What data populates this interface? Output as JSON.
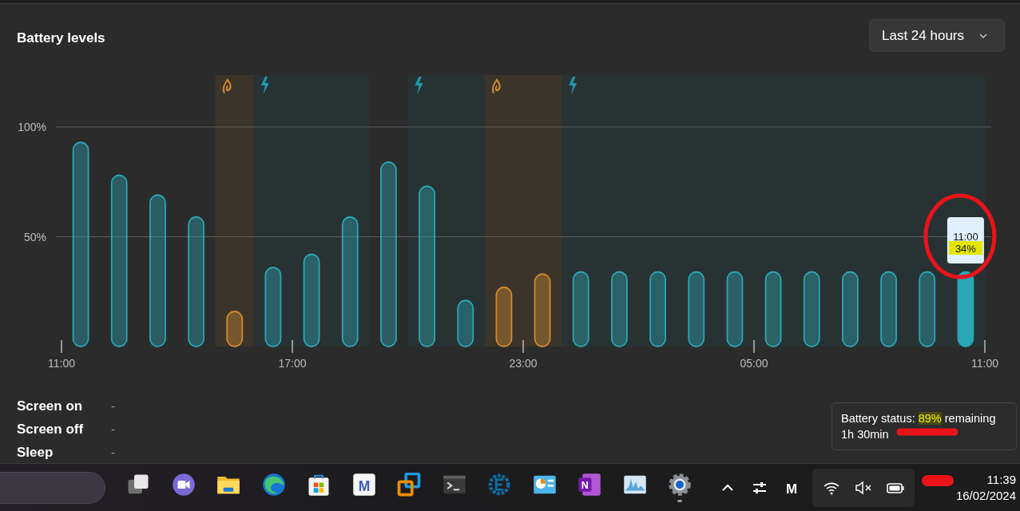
{
  "header": {
    "title": "Battery levels",
    "range_dropdown": {
      "label": "Last 24 hours"
    }
  },
  "chart": {
    "chart_data": {
      "type": "bar",
      "categories": [
        null,
        null,
        null,
        null,
        null,
        null,
        null,
        null,
        null,
        null,
        null,
        null,
        null,
        null,
        null,
        null,
        null,
        null,
        null,
        null,
        null,
        null,
        null,
        null
      ],
      "series": [
        {
          "color": "#2aa7b5",
          "values": [
            93,
            78,
            69,
            59,
            null,
            36,
            42,
            59,
            84,
            73,
            21,
            null,
            null,
            34,
            34,
            34,
            34,
            34,
            34,
            34,
            34,
            34,
            34,
            34
          ]
        },
        {
          "color": "#d08a2e",
          "values": [
            null,
            null,
            null,
            null,
            16,
            null,
            null,
            null,
            null,
            null,
            null,
            27,
            33,
            null,
            null,
            null,
            null,
            null,
            null,
            null,
            null,
            null,
            null,
            null
          ]
        }
      ],
      "ylim": [
        0,
        100
      ],
      "yticks": [
        {
          "value": 50,
          "label": "50%"
        },
        {
          "value": 100,
          "label": "100%"
        }
      ]
    },
    "x_axis_labels": [
      "11:00",
      "17:00",
      "23:00",
      "05:00",
      "11:00"
    ],
    "slots": [
      {
        "kind": "plain"
      },
      {
        "kind": "plain"
      },
      {
        "kind": "plain"
      },
      {
        "kind": "plain"
      },
      {
        "kind": "saver"
      },
      {
        "kind": "charging"
      },
      {
        "kind": "charging"
      },
      {
        "kind": "charging"
      },
      {
        "kind": "plain"
      },
      {
        "kind": "charging"
      },
      {
        "kind": "charging"
      },
      {
        "kind": "saver"
      },
      {
        "kind": "saver"
      },
      {
        "kind": "charging"
      },
      {
        "kind": "charging"
      },
      {
        "kind": "charging"
      },
      {
        "kind": "charging"
      },
      {
        "kind": "charging"
      },
      {
        "kind": "charging"
      },
      {
        "kind": "charging"
      },
      {
        "kind": "charging"
      },
      {
        "kind": "charging"
      },
      {
        "kind": "charging"
      },
      {
        "kind": "charging"
      }
    ],
    "tooltip": {
      "time": "11:00",
      "value": "34%"
    }
  },
  "usage": [
    {
      "label": "Screen on",
      "value": "-"
    },
    {
      "label": "Screen off",
      "value": "-"
    },
    {
      "label": "Sleep",
      "value": "-"
    }
  ],
  "battery_tooltip": {
    "prefix": "Battery status:",
    "highlight": "89%",
    "suffix": "remaining",
    "detail": "1h 30min"
  },
  "taskbar": {
    "apps": [
      {
        "kind": "taskview",
        "open": false
      },
      {
        "kind": "meet",
        "open": false
      },
      {
        "kind": "folder",
        "open": false
      },
      {
        "kind": "browser",
        "open": false
      },
      {
        "kind": "store",
        "open": false
      },
      {
        "kind": "letter",
        "text": "M",
        "open": false
      },
      {
        "kind": "squares",
        "open": false
      },
      {
        "kind": "terminal",
        "open": false
      },
      {
        "kind": "cog",
        "open": false
      },
      {
        "kind": "panel",
        "open": false
      },
      {
        "kind": "notebook",
        "text": "N",
        "open": false
      },
      {
        "kind": "graph",
        "open": false
      },
      {
        "kind": "settings",
        "open": true
      }
    ],
    "tray": [
      {
        "kind": "chevron"
      },
      {
        "kind": "sliders"
      },
      {
        "kind": "mark",
        "text": "M"
      }
    ],
    "status": [
      {
        "kind": "wifi"
      },
      {
        "kind": "mute"
      },
      {
        "kind": "battery"
      }
    ],
    "time": "11:39",
    "date": "16/02/2024"
  }
}
